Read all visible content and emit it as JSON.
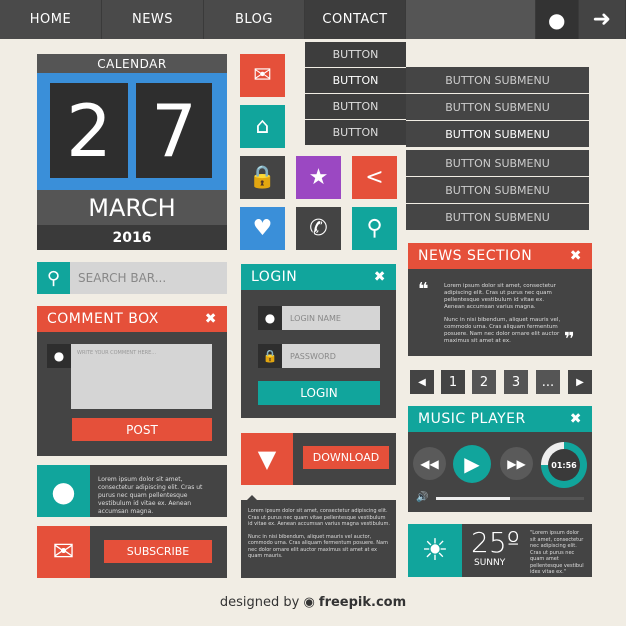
{
  "nav": {
    "items": [
      "HOME",
      "NEWS",
      "BLOG",
      "CONTACT"
    ],
    "user_icon": "user-icon",
    "logout_icon": "arrow-right-icon"
  },
  "dropdown": {
    "items": [
      "BUTTON",
      "BUTTON",
      "BUTTON",
      "BUTTON"
    ],
    "submenu": [
      "BUTTON SUBMENU",
      "BUTTON SUBMENU",
      "BUTTON SUBMENU",
      "BUTTON SUBMENU",
      "BUTTON SUBMENU",
      "BUTTON SUBMENU"
    ]
  },
  "calendar": {
    "title": "CALENDAR",
    "day1": "2",
    "day2": "7",
    "month": "MARCH",
    "year": "2016"
  },
  "icons": [
    "mail-icon",
    "home-icon",
    "lock-icon",
    "star-icon",
    "share-icon",
    "heart-icon",
    "phone-icon",
    "search-icon"
  ],
  "search": {
    "placeholder": "SEARCH BAR..."
  },
  "comment": {
    "title": "COMMENT BOX",
    "placeholder": "WRITE YOUR COMMENT HERE...",
    "post": "POST"
  },
  "login": {
    "title": "LOGIN",
    "name_placeholder": "LOGIN NAME",
    "password_placeholder": "PASSWORD",
    "button": "LOGIN"
  },
  "news": {
    "title": "NEWS SECTION",
    "p1": "Lorem ipsum dolor sit amet, consectetur adipiscing elit. Cras ut purus nec quam pellentesque vestibulum id vitae ex. Aenean accumsan varius magna.",
    "p2": "Nunc in nisi bibendum, aliquet mauris vel, commodo urna. Cras aliquam fermentum posuere. Nam nec dolor ornare elit auctor maximus sit amet at ex."
  },
  "pagination": {
    "pages": [
      "1",
      "2",
      "3",
      "..."
    ]
  },
  "music": {
    "title": "MUSIC PLAYER",
    "time": "01:56",
    "progress": 0.75,
    "volume": 0.5
  },
  "weather": {
    "temp": "25º",
    "condition": "SUNNY",
    "quote": "\"Lorem ipsum dolor sit amet, consectetur nec adipiscing elit. Cras ut purus nec quam amet pellentesque vestibul idex vitae ex.\""
  },
  "chat": {
    "text": "Lorem ipsum dolor sit amet, consectetur adipiscing elit. Cras ut purus nec quam pellentesque vestibulum id vitae ex. Aenean accumsan magna."
  },
  "subscribe": {
    "button": "SUBSCRIBE"
  },
  "download": {
    "button": "DOWNLOAD"
  },
  "textbox": {
    "p1": "Lorem ipsum dolor sit amet, consectetur adipiscing elit. Cras ut purus nec quam vitae pellentesque vestibulum id vitae ex. Aenean accumsan varius magna vestibulum.",
    "p2": "Nunc in nisi bibendum, aliquet mauris vel auctor, commodo urna. Cras aliquam fermentum posuere. Nam nec dolor ornare elit auctor maximus sit amet at ex quam mauris."
  },
  "footer": {
    "prefix": "designed by",
    "brand": "freepik.com"
  },
  "colors": {
    "red": "#e5503a",
    "teal": "#11a59c",
    "blue": "#3a8fd9",
    "purple": "#9b48c2",
    "dark": "#444444",
    "bg": "#f1ede4"
  }
}
